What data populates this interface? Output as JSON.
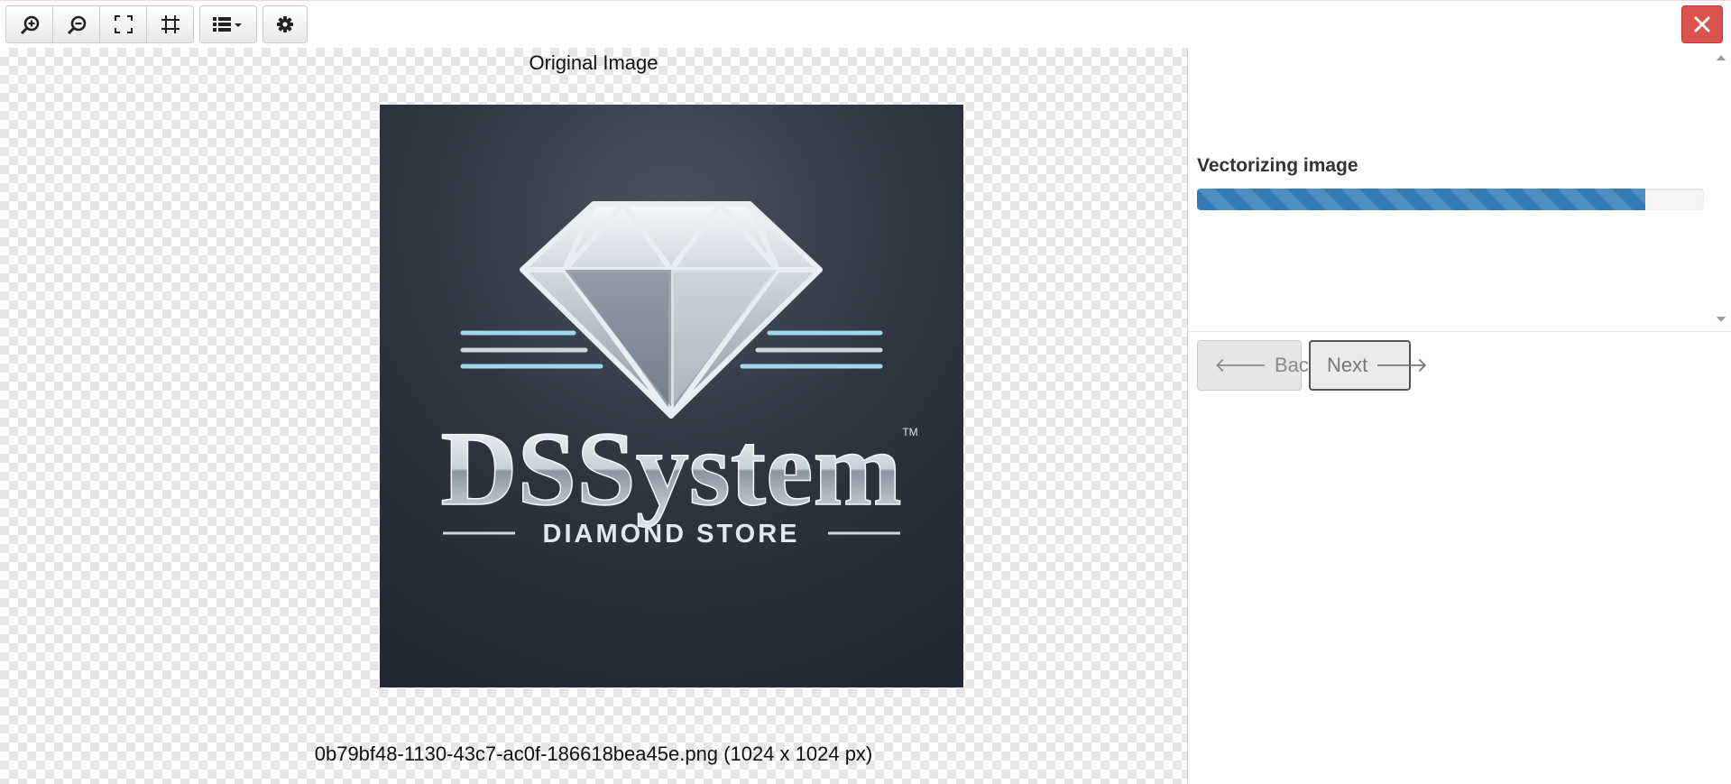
{
  "toolbar": {
    "buttons": [
      {
        "icon": "zoom-in-icon"
      },
      {
        "icon": "zoom-out-icon"
      },
      {
        "icon": "fit-to-screen-icon"
      },
      {
        "icon": "crop-icon"
      },
      {
        "icon": "list-dropdown-icon"
      },
      {
        "icon": "gear-icon"
      }
    ]
  },
  "close": {
    "icon": "close-icon",
    "color": "#d9534f"
  },
  "left_pane": {
    "title": "Original Image",
    "file_caption": "0b79bf48-1130-43c7-ac0f-186618bea45e.png (1024 x 1024 px)",
    "logo": {
      "brand": "DSSystem",
      "tagline": "DIAMOND STORE",
      "trademark": "TM"
    }
  },
  "right_pane": {
    "status": "Vectorizing image",
    "progress_fraction": 0.885,
    "progress_color": "#337ab7",
    "back_label": "Back",
    "next_label": "Next"
  }
}
